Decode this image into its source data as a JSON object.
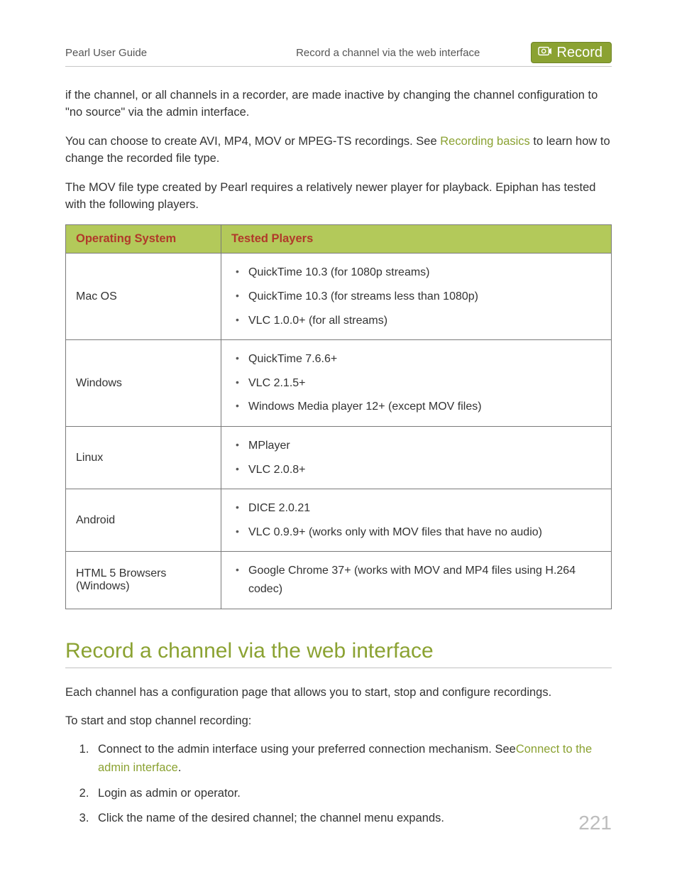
{
  "header": {
    "left": "Pearl User Guide",
    "center": "Record a channel via the web interface",
    "badge_label": "Record"
  },
  "intro": {
    "p1": "if the channel, or all channels in a recorder, are made inactive by changing the channel configuration to \"no source\" via the admin interface.",
    "p2_pre": "You can choose to create AVI, MP4, MOV or MPEG-TS recordings. See ",
    "p2_link": "Recording basics",
    "p2_post": " to learn how to change the recorded file type.",
    "p3": "The MOV file type created by Pearl requires a relatively newer player for playback. Epiphan has tested with the following players."
  },
  "table": {
    "headers": {
      "os": "Operating System",
      "players": "Tested Players"
    },
    "rows": [
      {
        "os": "Mac OS",
        "players": [
          "QuickTime 10.3 (for 1080p streams)",
          "QuickTime 10.3 (for streams less than 1080p)",
          "VLC 1.0.0+ (for all streams)"
        ]
      },
      {
        "os": "Windows",
        "players": [
          "QuickTime 7.6.6+",
          "VLC 2.1.5+",
          "Windows Media player 12+ (except MOV files)"
        ]
      },
      {
        "os": "Linux",
        "players": [
          "MPlayer",
          "VLC 2.0.8+"
        ]
      },
      {
        "os": "Android",
        "players": [
          "DICE 2.0.21",
          "VLC 0.9.9+ (works only with MOV files that have no audio)"
        ]
      },
      {
        "os": "HTML 5 Browsers (Windows)",
        "players": [
          "Google Chrome 37+ (works with MOV and MP4 files using H.264 codec)"
        ]
      }
    ]
  },
  "section": {
    "title": "Record a channel via the web interface",
    "p1": "Each channel has a configuration page that allows you to start, stop and configure recordings.",
    "p2": "To start and stop channel recording:",
    "steps": {
      "s1_pre": "Connect to the admin interface using your preferred connection mechanism. See",
      "s1_link": "Connect to the admin interface",
      "s1_post": ".",
      "s2": "Login as admin or operator.",
      "s3": "Click the name of the desired channel; the channel menu expands."
    }
  },
  "footer": {
    "page_number": "221"
  }
}
